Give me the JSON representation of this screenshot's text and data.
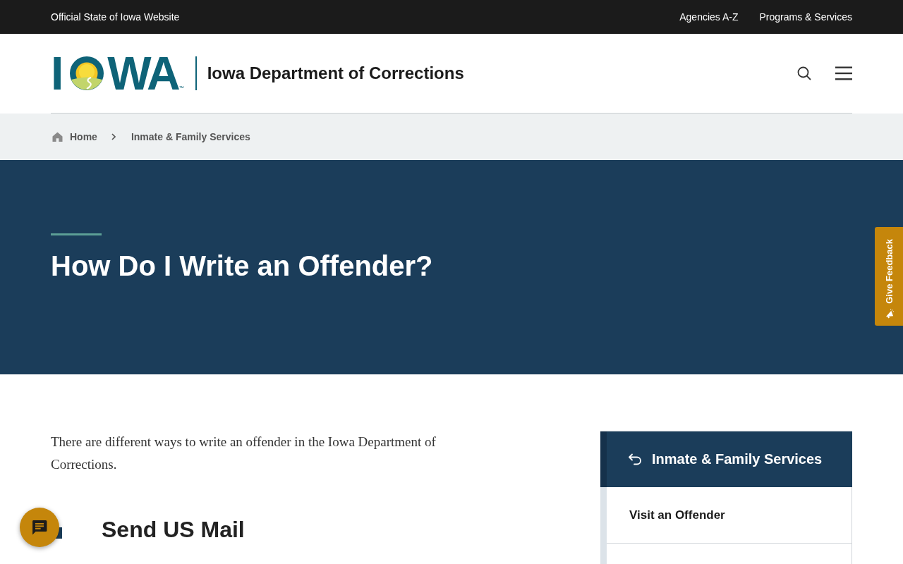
{
  "top_bar": {
    "title": "Official State of Iowa Website",
    "links": [
      "Agencies A-Z",
      "Programs & Services"
    ]
  },
  "header": {
    "logo": {
      "before": "I",
      "after": "WA",
      "mark": "™"
    },
    "agency_name": "Iowa Department of Corrections"
  },
  "breadcrumb": [
    {
      "label": "Home",
      "kind": "home"
    },
    {
      "label": "Inmate & Family Services",
      "kind": "link"
    }
  ],
  "hero": {
    "title": "How Do I Write an Offender?"
  },
  "content": {
    "intro": "There are different ways to write an offender in the Iowa Department of Corrections.",
    "sections": [
      {
        "heading": "Send US Mail"
      }
    ]
  },
  "side_nav": {
    "parent": "Inmate & Family Services",
    "items": [
      {
        "label": "Visit an Offender"
      }
    ]
  },
  "feedback_tab": {
    "label": "Give Feedback"
  }
}
